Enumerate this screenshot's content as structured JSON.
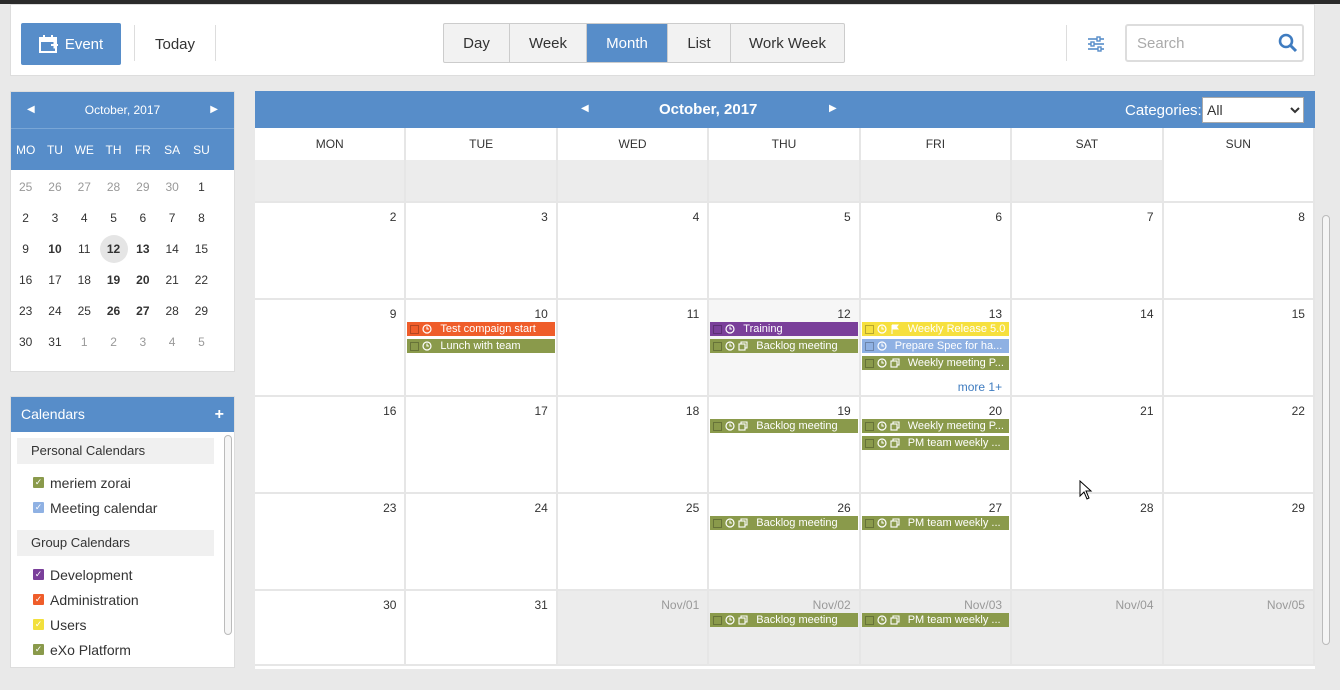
{
  "toolbar": {
    "event_label": "Event",
    "today_label": "Today",
    "views": [
      "Day",
      "Week",
      "Month",
      "List",
      "Work Week"
    ],
    "active_view": "Month",
    "search_placeholder": "Search"
  },
  "mini_calendar": {
    "title": "October, 2017",
    "weekdays": [
      "MO",
      "TU",
      "WE",
      "TH",
      "FR",
      "SA",
      "SU"
    ],
    "days": [
      [
        "25",
        "26",
        "27",
        "28",
        "29",
        "30",
        "1"
      ],
      [
        "2",
        "3",
        "4",
        "5",
        "6",
        "7",
        "8"
      ],
      [
        "9",
        "10",
        "11",
        "12",
        "13",
        "14",
        "15"
      ],
      [
        "16",
        "17",
        "18",
        "19",
        "20",
        "21",
        "22"
      ],
      [
        "23",
        "24",
        "25",
        "26",
        "27",
        "28",
        "29"
      ],
      [
        "30",
        "31",
        "1",
        "2",
        "3",
        "4",
        "5"
      ]
    ]
  },
  "calendars_panel": {
    "title": "Calendars",
    "personal_title": "Personal Calendars",
    "personal": [
      {
        "name": "meriem zorai",
        "color": "#8a9a4b"
      },
      {
        "name": "Meeting calendar",
        "color": "#8fb1e3"
      }
    ],
    "group_title": "Group Calendars",
    "group": [
      {
        "name": "Development",
        "color": "#7a3f9a"
      },
      {
        "name": "Administration",
        "color": "#ef5d2a"
      },
      {
        "name": "Users",
        "color": "#f2e03c"
      },
      {
        "name": "eXo Platform",
        "color": "#8a9a4b"
      }
    ]
  },
  "month_view": {
    "title": "October, 2017",
    "categories_label": "Categories:",
    "category_value": "All",
    "weekdays": [
      "MON",
      "TUE",
      "WED",
      "THU",
      "FRI",
      "SAT",
      "SUN"
    ],
    "weeks": [
      [
        "",
        "",
        "",
        "",
        "",
        "",
        ""
      ],
      [
        "2",
        "3",
        "4",
        "5",
        "6",
        "7",
        "8"
      ],
      [
        "9",
        "10",
        "11",
        "12",
        "13",
        "14",
        "15"
      ],
      [
        "16",
        "17",
        "18",
        "19",
        "20",
        "21",
        "22"
      ],
      [
        "23",
        "24",
        "25",
        "26",
        "27",
        "28",
        "29"
      ],
      [
        "30",
        "31",
        "Nov/01",
        "Nov/02",
        "Nov/03",
        "Nov/04",
        "Nov/05"
      ]
    ],
    "more_label": "more 1+",
    "events": {
      "test_compaign": "Test compaign start",
      "lunch": "Lunch with team",
      "training": "Training",
      "backlog": "Backlog meeting",
      "weekly_release": "Weekly Release 5.0",
      "prepare_spec": "Prepare Spec for ha...",
      "weekly_meeting": "Weekly meeting P...",
      "pm_team": "PM team weekly ..."
    },
    "colors": {
      "red": "#ef5d2a",
      "olive": "#8a9a4b",
      "purple": "#7a3f9a",
      "yellow": "#f6e03e",
      "blue": "#8fb1e3"
    }
  }
}
